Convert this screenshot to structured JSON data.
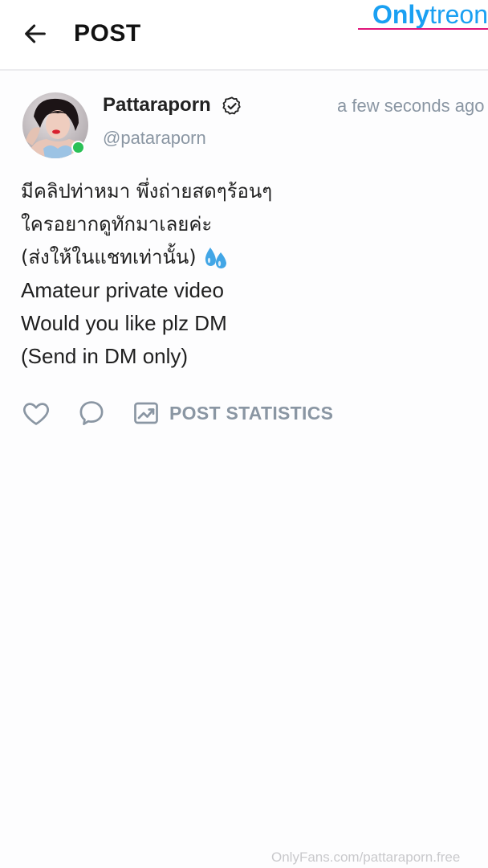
{
  "header": {
    "back_icon": "arrow-left-icon",
    "title": "POST"
  },
  "watermark": {
    "logo_part1": "Only",
    "logo_part2": "treon",
    "footer": "OnlyFans.com/pattaraporn.free"
  },
  "post": {
    "author": {
      "display_name": "Pattaraporn",
      "handle": "@pataraporn",
      "verified_icon": "verified-badge-icon",
      "online": true,
      "online_color": "#2bc157"
    },
    "timestamp": "a few seconds ago",
    "text_lines": [
      "มีคลิปท่าหมา พึ่งถ่ายสดๆร้อนๆ",
      "ใครอยากดูทักมาเลยค่ะ",
      "(ส่งให้ในแชทเท่านั้น)",
      "Amateur private video",
      "Would you like plz DM",
      "(Send in DM only)"
    ],
    "emoji_icon": "sweat-droplets-icon"
  },
  "actions": {
    "like_icon": "heart-icon",
    "comment_icon": "comment-bubble-icon",
    "stats_icon": "statistics-chart-icon",
    "stats_label": "POST STATISTICS"
  },
  "colors": {
    "muted": "#8a96a3",
    "brand_blue": "#1aa0f2",
    "brand_pink": "#e0147a"
  }
}
